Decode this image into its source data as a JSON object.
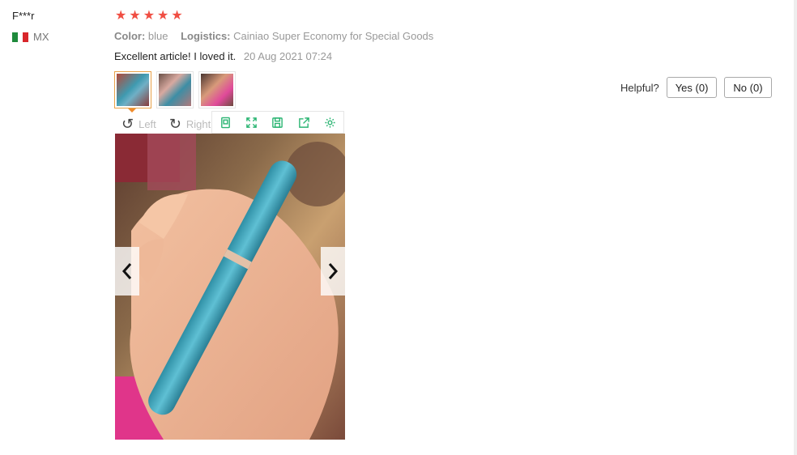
{
  "review": {
    "user_name": "F***r",
    "country_code": "MX",
    "rating": 5,
    "color_label": "Color:",
    "color_value": "blue",
    "logistics_label": "Logistics:",
    "logistics_value": "Cainiao Super Economy for Special Goods",
    "text": "Excellent article! I loved it.",
    "date": "20 Aug 2021 07:24"
  },
  "helpful": {
    "label": "Helpful?",
    "yes_label": "Yes (0)",
    "no_label": "No (0)"
  },
  "viewer": {
    "rotate_left_label": "Left",
    "rotate_right_label": "Right",
    "toolbar_icons": [
      "fit-screen-icon",
      "expand-icon",
      "save-icon",
      "share-icon",
      "settings-icon"
    ]
  },
  "colors": {
    "star": "#f04e43",
    "active_thumb_border": "#e8a24a",
    "toolbar_icon": "#2bb573"
  }
}
